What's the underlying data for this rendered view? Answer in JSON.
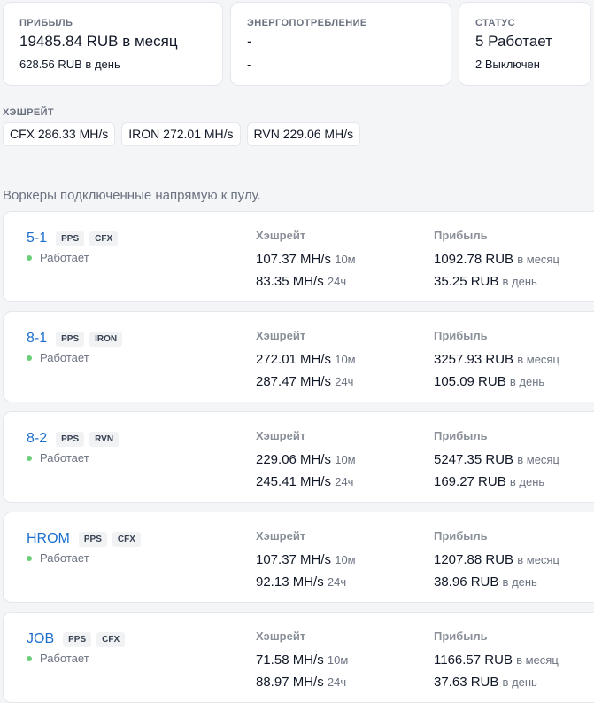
{
  "summary": {
    "profit": {
      "label": "ПРИБЫЛЬ",
      "main": "19485.84 RUB в месяц",
      "sub": "628.56 RUB в день"
    },
    "power": {
      "label": "ЭНЕРГОПОТРЕБЛЕНИЕ",
      "main": "-",
      "sub": "-"
    },
    "status": {
      "label": "СТАТУС",
      "main": "5 Работает",
      "sub": "2 Выключен"
    }
  },
  "hashrate": {
    "label": "ХЭШРЕЙТ",
    "chips": [
      "CFX 286.33 MH/s",
      "IRON 272.01 MH/s",
      "RVN 229.06 MH/s"
    ]
  },
  "workers_heading": "Воркеры подключенные напрямую к пулу.",
  "colors": {
    "accent": "#1d6fce",
    "status_ok": "#6ccf79"
  },
  "workers": [
    {
      "name": "5-1",
      "tags": [
        "PPS",
        "CFX"
      ],
      "status": "Работает",
      "hash_label": "Хэшрейт",
      "hash_10m": "107.37 MH/s",
      "unit_10m": "10м",
      "hash_24h": "83.35 MH/s",
      "unit_24h": "24ч",
      "profit_label": "Прибыль",
      "profit_month": "1092.78 RUB",
      "unit_month": "в месяц",
      "profit_day": "35.25 RUB",
      "unit_day": "в день"
    },
    {
      "name": "8-1",
      "tags": [
        "PPS",
        "IRON"
      ],
      "status": "Работает",
      "hash_label": "Хэшрейт",
      "hash_10m": "272.01 MH/s",
      "unit_10m": "10м",
      "hash_24h": "287.47 MH/s",
      "unit_24h": "24ч",
      "profit_label": "Прибыль",
      "profit_month": "3257.93 RUB",
      "unit_month": "в месяц",
      "profit_day": "105.09 RUB",
      "unit_day": "в день"
    },
    {
      "name": "8-2",
      "tags": [
        "PPS",
        "RVN"
      ],
      "status": "Работает",
      "hash_label": "Хэшрейт",
      "hash_10m": "229.06 MH/s",
      "unit_10m": "10м",
      "hash_24h": "245.41 MH/s",
      "unit_24h": "24ч",
      "profit_label": "Прибыль",
      "profit_month": "5247.35 RUB",
      "unit_month": "в месяц",
      "profit_day": "169.27 RUB",
      "unit_day": "в день"
    },
    {
      "name": "HROM",
      "tags": [
        "PPS",
        "CFX"
      ],
      "status": "Работает",
      "hash_label": "Хэшрейт",
      "hash_10m": "107.37 MH/s",
      "unit_10m": "10м",
      "hash_24h": "92.13 MH/s",
      "unit_24h": "24ч",
      "profit_label": "Прибыль",
      "profit_month": "1207.88 RUB",
      "unit_month": "в месяц",
      "profit_day": "38.96 RUB",
      "unit_day": "в день"
    },
    {
      "name": "JOB",
      "tags": [
        "PPS",
        "CFX"
      ],
      "status": "Работает",
      "hash_label": "Хэшрейт",
      "hash_10m": "71.58 MH/s",
      "unit_10m": "10м",
      "hash_24h": "88.97 MH/s",
      "unit_24h": "24ч",
      "profit_label": "Прибыль",
      "profit_month": "1166.57 RUB",
      "unit_month": "в месяц",
      "profit_day": "37.63 RUB",
      "unit_day": "в день"
    }
  ]
}
